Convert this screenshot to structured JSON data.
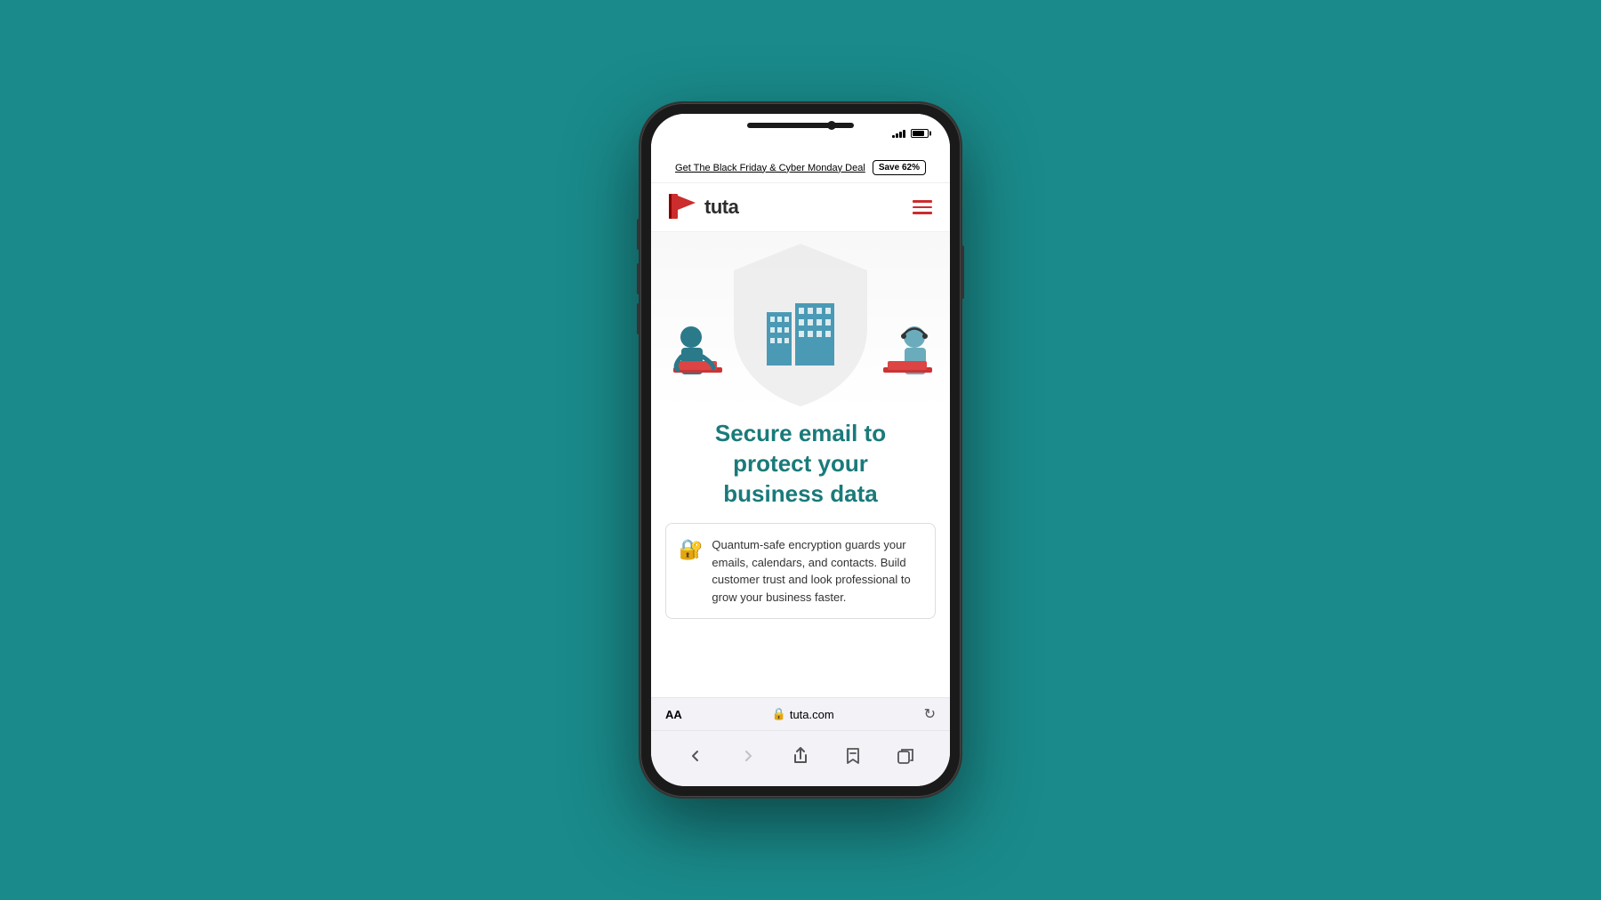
{
  "background_color": "#1a8a8a",
  "phone": {
    "status_bar": {
      "time": "",
      "battery": "70"
    },
    "promo_banner": {
      "text": "Get The Black Friday & Cyber Monday Deal",
      "badge_label": "Save 62%"
    },
    "nav_header": {
      "logo_alt": "tuta",
      "logo_text": "tuta"
    },
    "hero": {
      "heading_line1": "Secure email to",
      "heading_line2": "protect your",
      "heading_line3": "business data"
    },
    "info_card": {
      "text": "Quantum-safe encryption guards your emails, calendars, and contacts. Build customer trust and look professional to grow your business faster."
    },
    "url_bar": {
      "aa_label": "AA",
      "domain": "tuta.com",
      "lock_icon": "🔒"
    },
    "bottom_nav": {
      "back_label": "←",
      "forward_label": "→",
      "share_label": "↑",
      "bookmarks_label": "📖",
      "tabs_label": "⧉"
    }
  }
}
